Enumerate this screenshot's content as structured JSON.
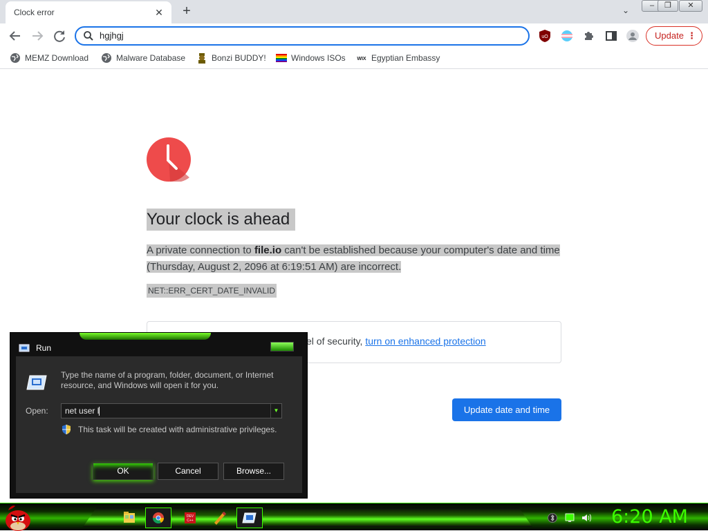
{
  "browser": {
    "tab_title": "Clock error",
    "tab_close": "✕",
    "new_tab": "+",
    "tab_search": "⌄",
    "omnibox_text": "hgjhgj",
    "update_label": "Update",
    "update_dots": "⋮",
    "window_buttons": [
      "–",
      "❐",
      "✕"
    ]
  },
  "bookmarks": [
    {
      "label": "MEMZ Download",
      "icon": "globe-icon"
    },
    {
      "label": "Malware Database",
      "icon": "globe-icon"
    },
    {
      "label": "Bonzi BUDDY!",
      "icon": "bonzi-icon"
    },
    {
      "label": "Windows ISOs",
      "icon": "rainbow-flag-icon"
    },
    {
      "label": "Egyptian Embassy",
      "icon": "wix-icon"
    }
  ],
  "error_page": {
    "heading": "Your clock is ahead",
    "message_pre": "A private connection to ",
    "message_host": "file.io",
    "message_post": " can't be established because your computer's date and time (Thursday, August 2, 2096 at 6:19:51 AM) are incorrect.",
    "error_code": "NET::ERR_CERT_DATE_INVALID",
    "security_partial": "el of security, ",
    "security_link": "turn on enhanced protection",
    "update_button": "Update date and time"
  },
  "run_dialog": {
    "title": "Run",
    "description": "Type the name of a program, folder, document, or Internet resource, and Windows will open it for you.",
    "open_label": "Open:",
    "input_value": "net user l",
    "admin_note": "This task will be created with administrative privileges.",
    "buttons": {
      "ok": "OK",
      "cancel": "Cancel",
      "browse": "Browse..."
    }
  },
  "taskbar": {
    "clock": "6:20 AM",
    "items": [
      "explorer-icon",
      "chrome-icon",
      "dev-cpp-icon",
      "paint-icon",
      "run-icon"
    ]
  },
  "colors": {
    "accent_blue": "#1a73e8",
    "error_red": "#ee4b4b",
    "taskbar_green": "#3cff00"
  }
}
